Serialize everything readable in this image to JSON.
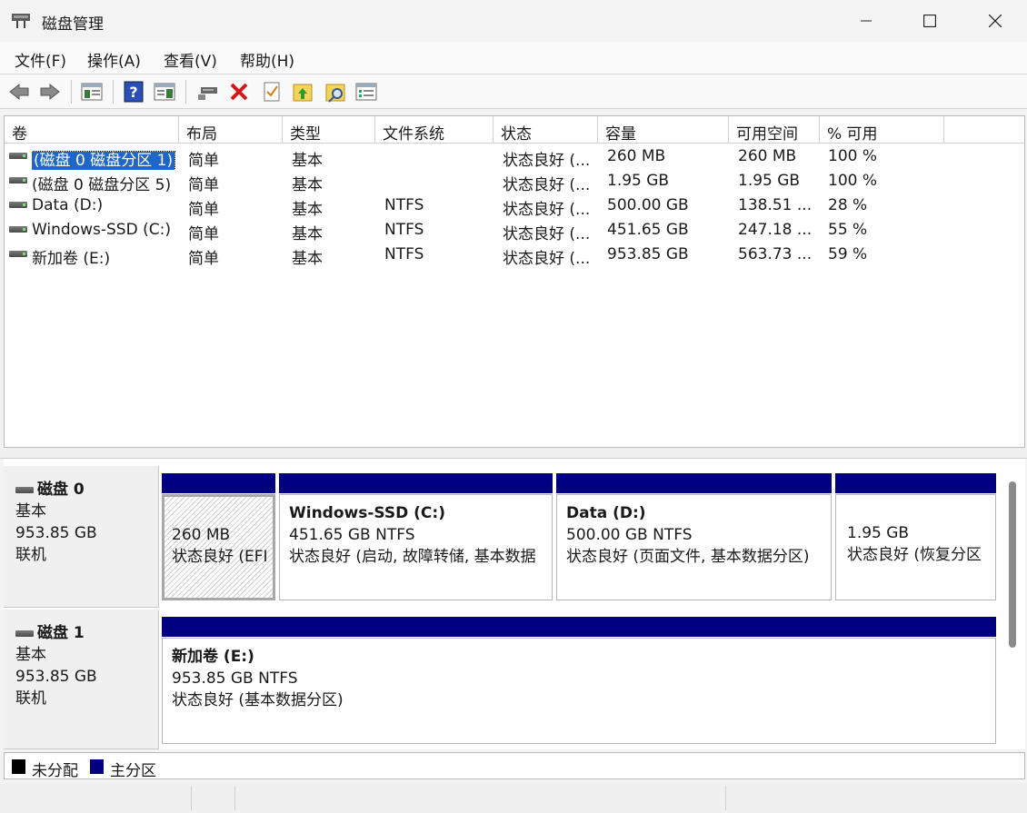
{
  "window": {
    "title": "磁盘管理"
  },
  "menu": [
    "文件(F)",
    "操作(A)",
    "查看(V)",
    "帮助(H)"
  ],
  "toolbar": {
    "icons": [
      "back-arrow-icon",
      "forward-arrow-icon",
      "console-tree-icon",
      "help-icon",
      "action-pane-icon",
      "connect-disk-icon",
      "delete-icon",
      "checklist-icon",
      "folder-up-icon",
      "folder-search-icon",
      "properties-icon"
    ]
  },
  "columns": [
    "卷",
    "布局",
    "类型",
    "文件系统",
    "状态",
    "容量",
    "可用空间",
    "% 可用"
  ],
  "volumes": [
    {
      "name": "(磁盘 0 磁盘分区 1)",
      "layout": "简单",
      "type": "基本",
      "fs": "",
      "status": "状态良好 (...",
      "capacity": "260 MB",
      "free": "260 MB",
      "pct": "100 %"
    },
    {
      "name": "(磁盘 0 磁盘分区 5)",
      "layout": "简单",
      "type": "基本",
      "fs": "",
      "status": "状态良好 (...",
      "capacity": "1.95 GB",
      "free": "1.95 GB",
      "pct": "100 %"
    },
    {
      "name": "Data (D:)",
      "layout": "简单",
      "type": "基本",
      "fs": "NTFS",
      "status": "状态良好 (...",
      "capacity": "500.00 GB",
      "free": "138.51 ...",
      "pct": "28 %"
    },
    {
      "name": "Windows-SSD (C:)",
      "layout": "简单",
      "type": "基本",
      "fs": "NTFS",
      "status": "状态良好 (...",
      "capacity": "451.65 GB",
      "free": "247.18 ...",
      "pct": "55 %"
    },
    {
      "name": "新加卷 (E:)",
      "layout": "简单",
      "type": "基本",
      "fs": "NTFS",
      "status": "状态良好 (...",
      "capacity": "953.85 GB",
      "free": "563.73 ...",
      "pct": "59 %"
    }
  ],
  "disks": [
    {
      "title": "磁盘 0",
      "type": "基本",
      "size": "953.85 GB",
      "state": "联机",
      "partitions": [
        {
          "name": "",
          "line1": "260 MB",
          "line2": "状态良好 (EFI"
        },
        {
          "name": "Windows-SSD  (C:)",
          "line1": "451.65 GB NTFS",
          "line2": "状态良好 (启动, 故障转储, 基本数据"
        },
        {
          "name": "Data  (D:)",
          "line1": "500.00 GB NTFS",
          "line2": "状态良好 (页面文件, 基本数据分区)"
        },
        {
          "name": "",
          "line1": "1.95 GB",
          "line2": "状态良好 (恢复分区"
        }
      ]
    },
    {
      "title": "磁盘 1",
      "type": "基本",
      "size": "953.85 GB",
      "state": "联机",
      "partitions": [
        {
          "name": "新加卷  (E:)",
          "line1": "953.85 GB NTFS",
          "line2": "状态良好 (基本数据分区)"
        }
      ]
    }
  ],
  "legend": [
    {
      "label": "未分配",
      "color": "#000000"
    },
    {
      "label": "主分区",
      "color": "#000080"
    }
  ]
}
